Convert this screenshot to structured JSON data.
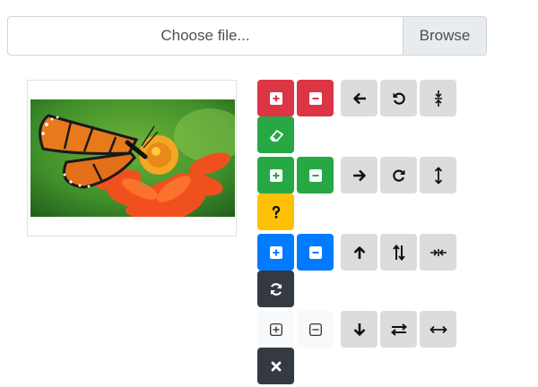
{
  "file_input": {
    "placeholder": "Choose file...",
    "browse_label": "Browse"
  },
  "preview": {
    "subject": "Monarch butterfly on orange flower"
  },
  "colors": {
    "danger": "#dc3545",
    "success": "#28a745",
    "primary": "#007bff",
    "warning": "#ffc107",
    "dark": "#343a40",
    "light": "#f8f9fa",
    "neutral": "#dcdcdc"
  },
  "brush_tools": [
    {
      "name": "add-red-button",
      "icon": "plus-square-icon",
      "color": "danger"
    },
    {
      "name": "remove-red-button",
      "icon": "minus-square-icon",
      "color": "danger"
    },
    {
      "name": "eraser-button",
      "icon": "eraser-icon",
      "color": "success"
    },
    {
      "name": "add-green-button",
      "icon": "plus-square-icon",
      "color": "success"
    },
    {
      "name": "remove-green-button",
      "icon": "minus-square-icon",
      "color": "success"
    },
    {
      "name": "unknown-button",
      "icon": "question-icon",
      "color": "warning"
    },
    {
      "name": "add-blue-button",
      "icon": "plus-square-icon",
      "color": "primary"
    },
    {
      "name": "remove-blue-button",
      "icon": "minus-square-icon",
      "color": "primary"
    },
    {
      "name": "refresh-button",
      "icon": "sync-icon",
      "color": "dark"
    },
    {
      "name": "add-outline-button",
      "icon": "plus-square-outline-icon",
      "color": "light"
    },
    {
      "name": "remove-outline-button",
      "icon": "minus-square-outline-icon",
      "color": "light"
    },
    {
      "name": "clear-button",
      "icon": "times-icon",
      "color": "dark"
    }
  ],
  "transform_tools": [
    {
      "name": "move-left-button",
      "icon": "arrow-left-icon"
    },
    {
      "name": "rotate-left-button",
      "icon": "rotate-left-icon"
    },
    {
      "name": "compress-vertical-button",
      "icon": "compress-vertical-icon"
    },
    {
      "name": "move-right-button",
      "icon": "arrow-right-icon"
    },
    {
      "name": "rotate-right-button",
      "icon": "rotate-right-icon"
    },
    {
      "name": "expand-vertical-button",
      "icon": "expand-vertical-icon"
    },
    {
      "name": "move-up-button",
      "icon": "arrow-up-icon"
    },
    {
      "name": "flip-vertical-button",
      "icon": "flip-vertical-icon"
    },
    {
      "name": "compress-horizontal-button",
      "icon": "compress-horizontal-icon"
    },
    {
      "name": "move-down-button",
      "icon": "arrow-down-icon"
    },
    {
      "name": "flip-horizontal-button",
      "icon": "flip-horizontal-icon"
    },
    {
      "name": "expand-horizontal-button",
      "icon": "expand-horizontal-icon"
    }
  ]
}
